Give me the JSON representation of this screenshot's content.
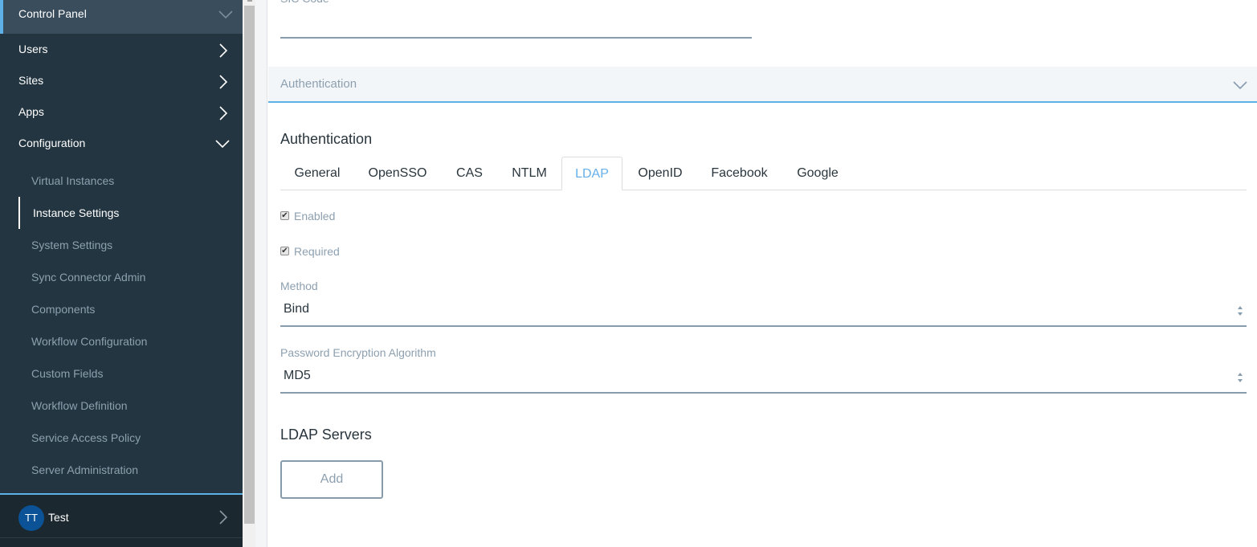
{
  "sidebar": {
    "control_panel": "Control Panel",
    "nav": [
      {
        "label": "Users",
        "icon": "chevron-right-icon"
      },
      {
        "label": "Sites",
        "icon": "chevron-right-icon"
      },
      {
        "label": "Apps",
        "icon": "chevron-right-icon"
      },
      {
        "label": "Configuration",
        "icon": "chevron-down-icon"
      }
    ],
    "configuration_items": [
      {
        "label": "Virtual Instances",
        "active": false
      },
      {
        "label": "Instance Settings",
        "active": true
      },
      {
        "label": "System Settings",
        "active": false
      },
      {
        "label": "Sync Connector Admin",
        "active": false
      },
      {
        "label": "Components",
        "active": false
      },
      {
        "label": "Workflow Configuration",
        "active": false
      },
      {
        "label": "Custom Fields",
        "active": false
      },
      {
        "label": "Workflow Definition",
        "active": false
      },
      {
        "label": "Service Access Policy",
        "active": false
      },
      {
        "label": "Server Administration",
        "active": false
      }
    ],
    "user": {
      "initials": "TT",
      "name": "Test"
    }
  },
  "main": {
    "cut_field_label": "SIC Code",
    "panel_header": "Authentication",
    "section_title": "Authentication",
    "tabs": [
      {
        "label": "General",
        "active": false
      },
      {
        "label": "OpenSSO",
        "active": false
      },
      {
        "label": "CAS",
        "active": false
      },
      {
        "label": "NTLM",
        "active": false
      },
      {
        "label": "LDAP",
        "active": true
      },
      {
        "label": "OpenID",
        "active": false
      },
      {
        "label": "Facebook",
        "active": false
      },
      {
        "label": "Google",
        "active": false
      }
    ],
    "checkboxes": [
      {
        "label": "Enabled",
        "checked": true
      },
      {
        "label": "Required",
        "checked": true
      }
    ],
    "method": {
      "label": "Method",
      "value": "Bind"
    },
    "password_encryption": {
      "label": "Password Encryption Algorithm",
      "value": "MD5"
    },
    "ldap_servers": {
      "title": "LDAP Servers",
      "add_label": "Add"
    }
  },
  "colors": {
    "sidebar_bg": "#223540",
    "accent": "#5eb1e6",
    "active_tab": "#65b0ea",
    "avatar": "#0b5396"
  }
}
